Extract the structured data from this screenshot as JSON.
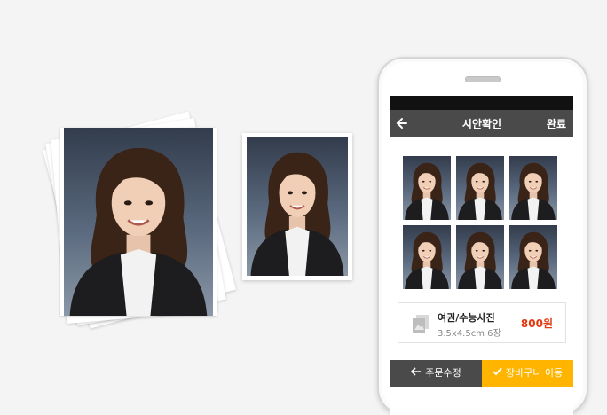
{
  "header": {
    "back_icon": "back-arrow-icon",
    "title": "시안확인",
    "done_label": "완료"
  },
  "product": {
    "name": "여권/수능사진",
    "spec": "3.5x4.5cm 6장",
    "price": "800원",
    "icon": "photo-icon"
  },
  "actions": {
    "edit_label": "주문수정",
    "edit_icon": "left-arrow-icon",
    "cart_label": "장바구니 이동",
    "cart_icon": "check-icon"
  },
  "colors": {
    "header_bg": "#4a4a4a",
    "accent": "#ffb400",
    "price": "#e23b12"
  }
}
